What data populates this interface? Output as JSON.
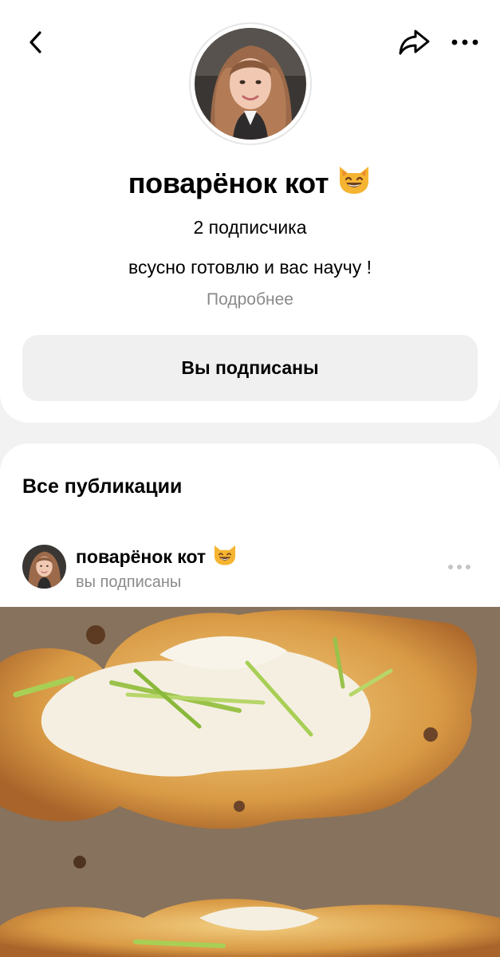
{
  "topbar": {
    "back_icon": "chevron-left-icon",
    "share_icon": "share-arrow-icon",
    "more_icon": "more-horizontal-icon"
  },
  "profile": {
    "name": "поварёнок кот",
    "emoji": "😺",
    "subscribers": "2 подписчика",
    "description": "всусно готовлю и вас научу !",
    "more_link": "Подробнее",
    "subscribed_button": "Вы подписаны"
  },
  "feed": {
    "section_title": "Все публикации",
    "post": {
      "author": "поварёнок кот",
      "emoji": "😺",
      "status": "вы подписаны"
    }
  },
  "colors": {
    "background": "#f2f2f2",
    "card": "#ffffff",
    "button": "#f0f0f0",
    "muted_text": "#8a8a8a"
  }
}
